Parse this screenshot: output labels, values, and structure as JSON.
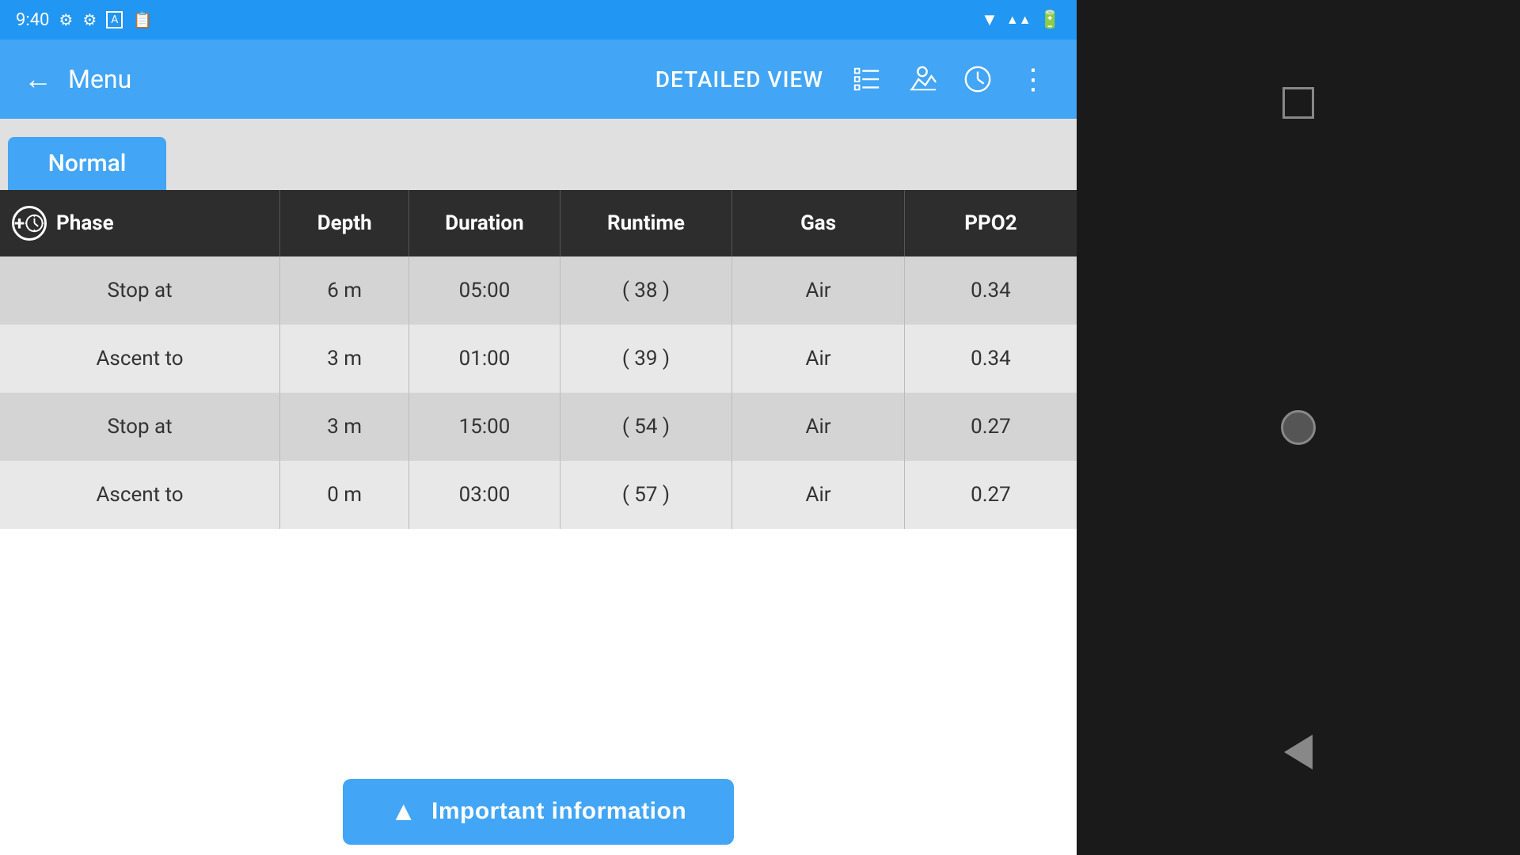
{
  "statusBar": {
    "time": "9:40"
  },
  "toolbar": {
    "back_label": "←",
    "menu_label": "Menu",
    "title": "DETAILED VIEW",
    "more_label": "⋮"
  },
  "tabs": [
    {
      "label": "Normal",
      "active": true
    }
  ],
  "table": {
    "headers": {
      "phase": "Phase",
      "depth": "Depth",
      "duration": "Duration",
      "runtime": "Runtime",
      "gas": "Gas",
      "ppo2": "PPO2"
    },
    "rows": [
      {
        "phase": "Stop at",
        "depth": "6 m",
        "duration": "05:00",
        "runtime": "( 38 )",
        "gas": "Air",
        "ppo2": "0.34"
      },
      {
        "phase": "Ascent to",
        "depth": "3 m",
        "duration": "01:00",
        "runtime": "( 39 )",
        "gas": "Air",
        "ppo2": "0.34"
      },
      {
        "phase": "Stop at",
        "depth": "3 m",
        "duration": "15:00",
        "runtime": "( 54 )",
        "gas": "Air",
        "ppo2": "0.27"
      },
      {
        "phase": "Ascent to",
        "depth": "0 m",
        "duration": "03:00",
        "runtime": "( 57 )",
        "gas": "Air",
        "ppo2": "0.27"
      }
    ]
  },
  "footer": {
    "important_button": "Important information",
    "warning_icon": "▲"
  },
  "colors": {
    "primary": "#42A5F5",
    "header_bg": "#2d2d2d"
  }
}
